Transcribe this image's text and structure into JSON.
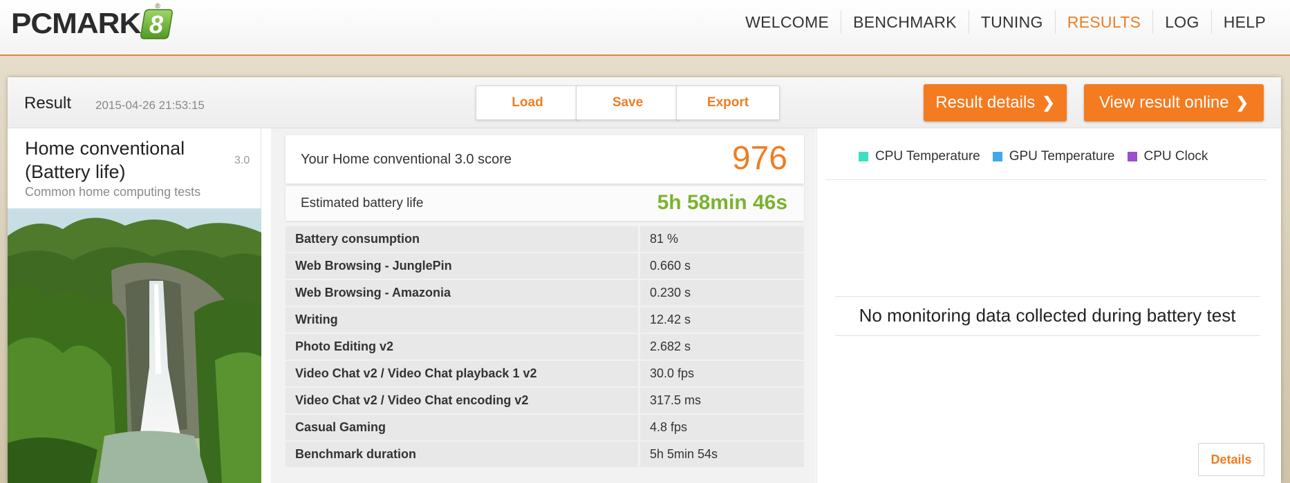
{
  "app": {
    "logo_text": "PCMARK",
    "logo_badge": "8",
    "logo_reg": "®"
  },
  "nav": {
    "items": [
      {
        "label": "WELCOME"
      },
      {
        "label": "BENCHMARK"
      },
      {
        "label": "TUNING"
      },
      {
        "label": "RESULTS",
        "active": true
      },
      {
        "label": "LOG"
      },
      {
        "label": "HELP"
      }
    ]
  },
  "result": {
    "title": "Result",
    "date": "2015-04-26 21:53:15",
    "buttons": {
      "load": "Load",
      "save": "Save",
      "export": "Export",
      "result_details": "Result details",
      "view_online": "View result online"
    }
  },
  "test": {
    "name": "Home conventional (Battery life)",
    "version": "3.0",
    "description": "Common home computing tests"
  },
  "score": {
    "label": "Your Home conventional 3.0 score",
    "value": "976"
  },
  "battery": {
    "label": "Estimated battery life",
    "value": "5h 58min 46s"
  },
  "metrics": [
    {
      "name": "Battery consumption",
      "value": "81 %"
    },
    {
      "name": "Web Browsing - JunglePin",
      "value": "0.660 s"
    },
    {
      "name": "Web Browsing - Amazonia",
      "value": "0.230 s"
    },
    {
      "name": "Writing",
      "value": "12.42 s"
    },
    {
      "name": "Photo Editing v2",
      "value": "2.682 s"
    },
    {
      "name": "Video Chat v2 / Video Chat playback 1 v2",
      "value": "30.0 fps"
    },
    {
      "name": "Video Chat v2 / Video Chat encoding v2",
      "value": "317.5 ms"
    },
    {
      "name": "Casual Gaming",
      "value": "4.8 fps"
    },
    {
      "name": "Benchmark duration",
      "value": "5h 5min 54s"
    }
  ],
  "monitoring": {
    "legend": [
      {
        "label": "CPU Temperature",
        "color": "#3fe0c0"
      },
      {
        "label": "GPU Temperature",
        "color": "#42a8ee"
      },
      {
        "label": "CPU Clock",
        "color": "#9b4fd0"
      }
    ],
    "message": "No monitoring data collected during battery test",
    "details_label": "Details"
  },
  "colors": {
    "accent": "#ef7d22",
    "battery_green": "#7bb32e"
  }
}
